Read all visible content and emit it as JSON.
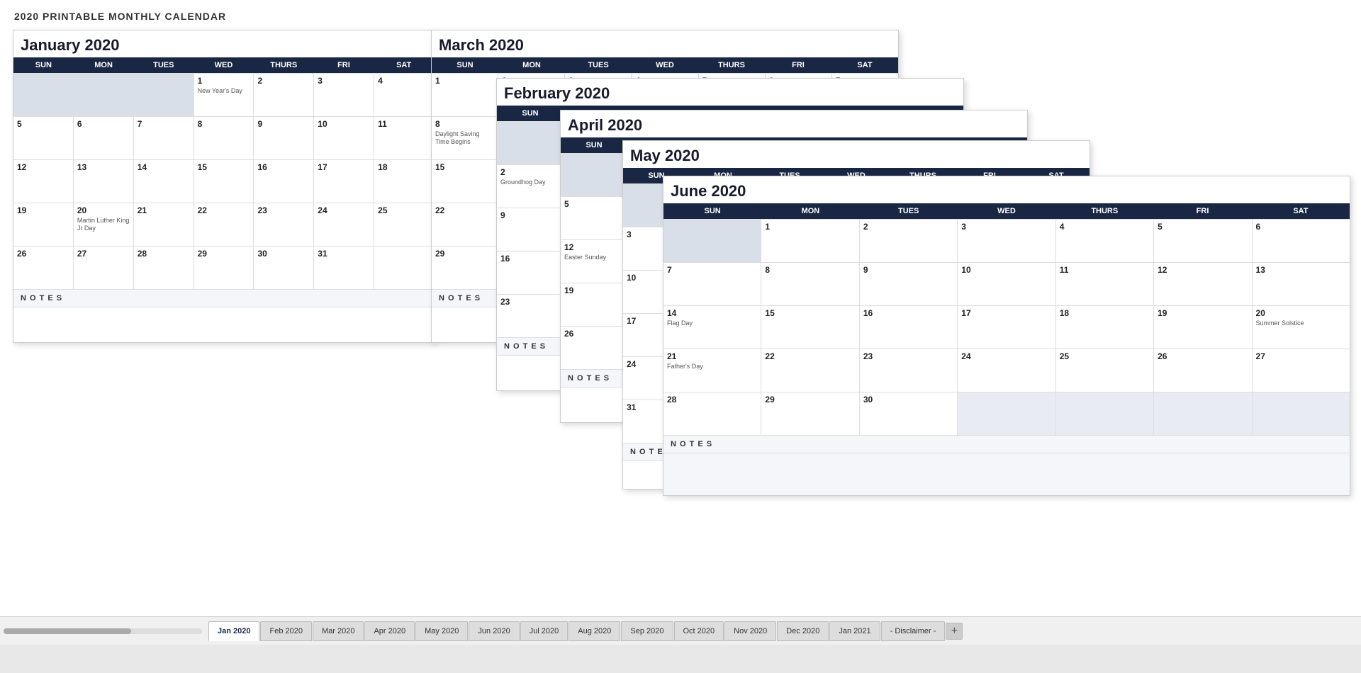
{
  "page": {
    "title": "2020 PRINTABLE MONTHLY CALENDAR"
  },
  "tabs": [
    {
      "label": "Jan 2020",
      "active": true
    },
    {
      "label": "Feb 2020",
      "active": false
    },
    {
      "label": "Mar 2020",
      "active": false
    },
    {
      "label": "Apr 2020",
      "active": false
    },
    {
      "label": "May 2020",
      "active": false
    },
    {
      "label": "Jun 2020",
      "active": false
    },
    {
      "label": "Jul 2020",
      "active": false
    },
    {
      "label": "Aug 2020",
      "active": false
    },
    {
      "label": "Sep 2020",
      "active": false
    },
    {
      "label": "Oct 2020",
      "active": false
    },
    {
      "label": "Nov 2020",
      "active": false
    },
    {
      "label": "Dec 2020",
      "active": false
    },
    {
      "label": "Jan 2021",
      "active": false
    },
    {
      "label": "- Disclaimer -",
      "active": false
    }
  ]
}
